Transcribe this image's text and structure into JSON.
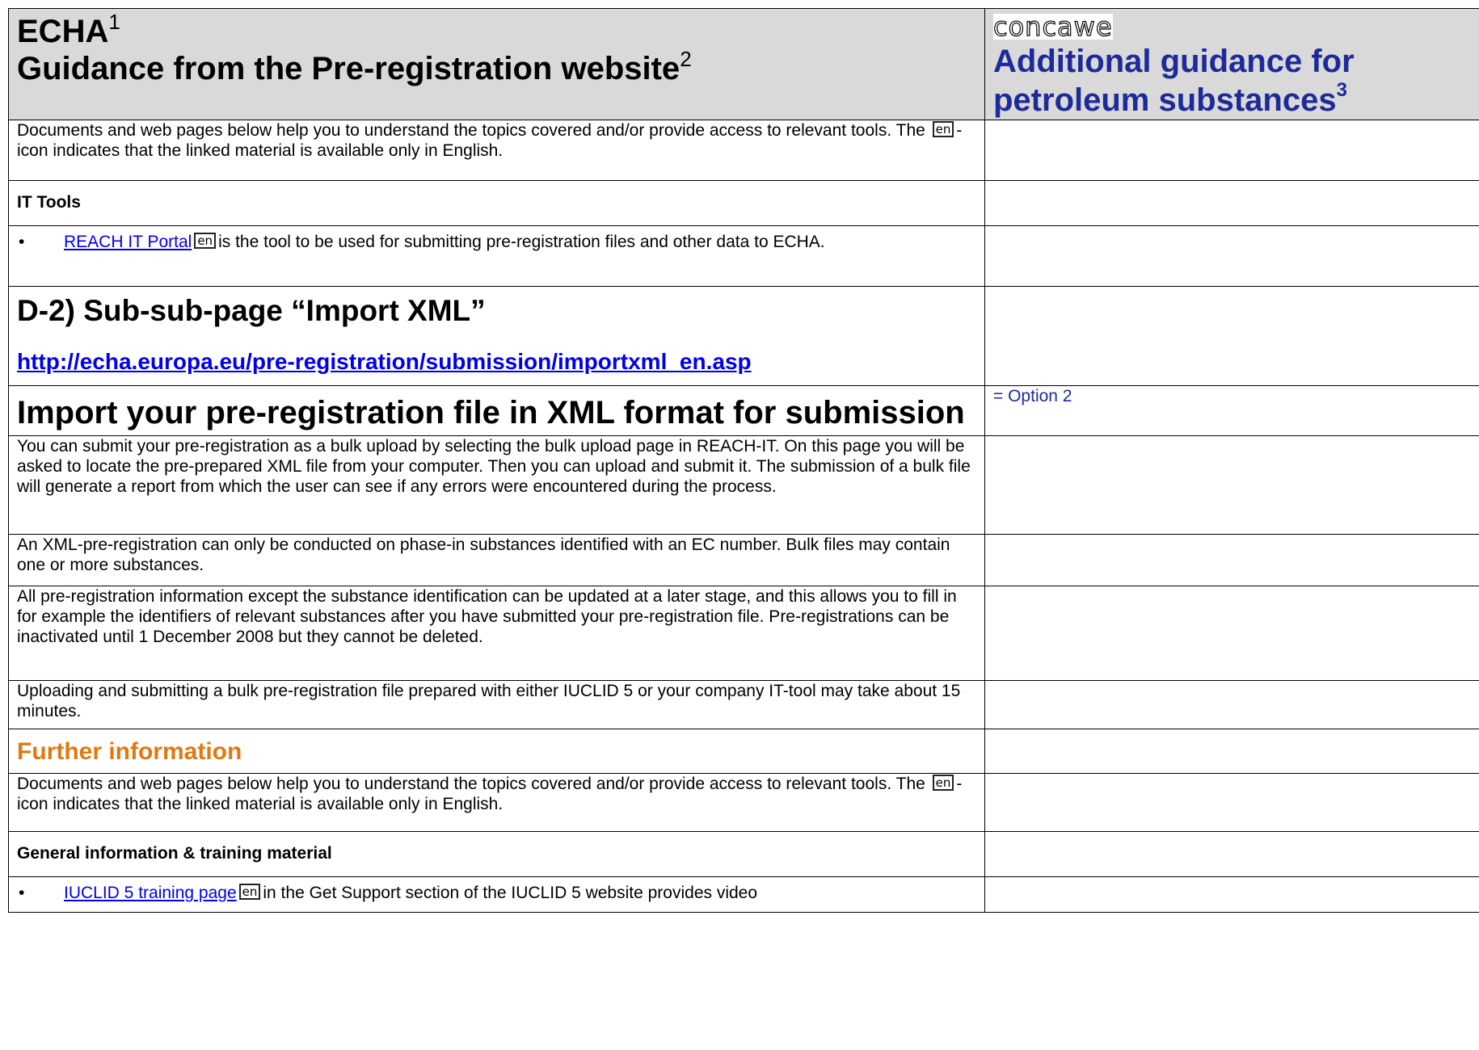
{
  "header": {
    "echa_label": "ECHA",
    "echa_footnote": "1",
    "guidance_title": "Guidance from the Pre-registration website",
    "guidance_footnote": "2",
    "logo_text": "concawe",
    "additional_title": "Additional guidance for petroleum substances",
    "additional_footnote": "3"
  },
  "rows": {
    "intro1": {
      "before": "Documents and web pages below help you to understand the topics covered and/or provide access to relevant tools. The ",
      "icon": "en",
      "after": "-icon indicates that the linked material is available only in English."
    },
    "it_tools_heading": "IT Tools",
    "reach_it": {
      "bullet": "•",
      "link": "REACH IT Portal",
      "icon": "en",
      "text": "is the tool to be used for submitting pre-registration files and other data to ECHA."
    },
    "subpage_title": "D-2) Sub-sub-page “Import XML”",
    "subpage_url": "http://echa.europa.eu/pre-registration/submission/importxml_en.asp",
    "import_heading": "Import your pre-registration file in XML format for submission",
    "option_note": "= Option 2",
    "para_bulk": "You can submit your pre-registration as a bulk upload by selecting the bulk upload page in REACH-IT. On this page you will be asked to locate the pre-prepared XML file from your computer. Then you can upload and submit it. The submission of a bulk file will generate a report from which the user can see if any errors were encountered during the process.",
    "para_xml": "An XML-pre-registration can only be conducted on phase-in substances identified with an EC number. Bulk files may contain one or more substances.",
    "para_update": "All pre-registration information except the substance identification can be updated at a later stage, and this allows you to fill in for example the identifiers of relevant substances after you have submitted your pre-registration file. Pre-registrations can be inactivated until 1 December 2008 but they cannot be deleted.",
    "para_upload": "Uploading and submitting a bulk pre-registration file prepared with either IUCLID 5 or your company IT-tool may take about 15 minutes.",
    "further_heading": "Further information",
    "intro2": {
      "before": "Documents and web pages below help you to understand the topics covered and/or provide access to relevant tools. The ",
      "icon": "en",
      "after": "-icon indicates that the linked material is available only in English."
    },
    "general_heading": "General information & training material",
    "iuclid": {
      "bullet": "•",
      "link": "IUCLID 5 training page",
      "icon": "en",
      "text": "in the Get Support section of the IUCLID 5 website provides video"
    }
  },
  "colors": {
    "header_bg": "#d9d9d9",
    "concawe_blue": "#1d2a9a",
    "link_blue": "#0000ee",
    "further_orange": "#e07a10"
  }
}
